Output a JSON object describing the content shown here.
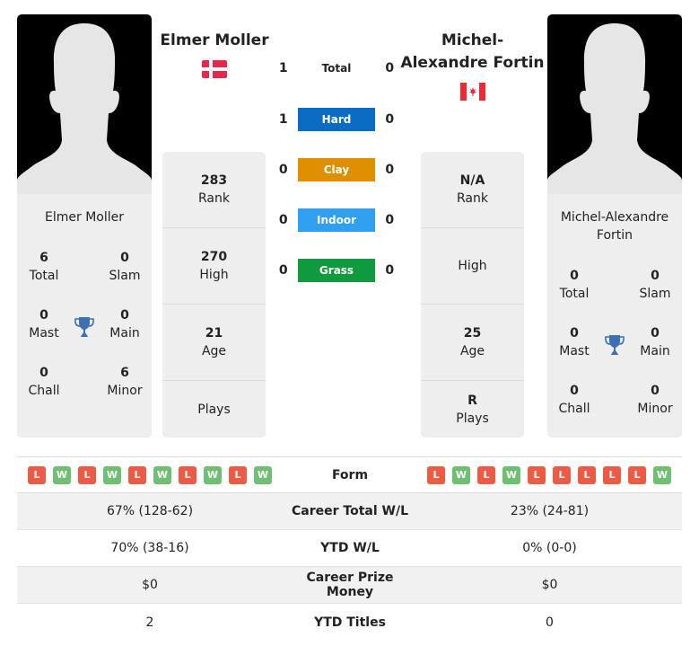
{
  "player1": {
    "name": "Elmer Moller",
    "card_name": "Elmer Moller",
    "country": "Denmark",
    "flag_icon": "denmark-flag-icon",
    "titles": {
      "total": {
        "value": "6",
        "label": "Total"
      },
      "slam": {
        "value": "0",
        "label": "Slam"
      },
      "mast": {
        "value": "0",
        "label": "Mast"
      },
      "main": {
        "value": "0",
        "label": "Main"
      },
      "chall": {
        "value": "0",
        "label": "Chall"
      },
      "minor": {
        "value": "6",
        "label": "Minor"
      }
    },
    "info": {
      "rank": {
        "value": "283",
        "label": "Rank"
      },
      "high": {
        "value": "270",
        "label": "High"
      },
      "age": {
        "value": "21",
        "label": "Age"
      },
      "plays": {
        "value": "",
        "label": "Plays"
      }
    },
    "form": [
      "L",
      "W",
      "L",
      "W",
      "L",
      "W",
      "L",
      "W",
      "L",
      "W"
    ]
  },
  "player2": {
    "name": "Michel-Alexandre Fortin",
    "name_line1": "Michel-",
    "name_line2": "Alexandre Fortin",
    "card_name": "Michel-Alexandre Fortin",
    "country": "Canada",
    "flag_icon": "canada-flag-icon",
    "titles": {
      "total": {
        "value": "0",
        "label": "Total"
      },
      "slam": {
        "value": "0",
        "label": "Slam"
      },
      "mast": {
        "value": "0",
        "label": "Mast"
      },
      "main": {
        "value": "0",
        "label": "Main"
      },
      "chall": {
        "value": "0",
        "label": "Chall"
      },
      "minor": {
        "value": "0",
        "label": "Minor"
      }
    },
    "info": {
      "rank": {
        "value": "N/A",
        "label": "Rank"
      },
      "high": {
        "value": "",
        "label": "High"
      },
      "age": {
        "value": "25",
        "label": "Age"
      },
      "plays": {
        "value": "R",
        "label": "Plays"
      }
    },
    "form": [
      "L",
      "W",
      "L",
      "W",
      "L",
      "L",
      "L",
      "L",
      "L",
      "W"
    ]
  },
  "h2h": [
    {
      "surface": "Total",
      "p1": "1",
      "p2": "0",
      "color": ""
    },
    {
      "surface": "Hard",
      "p1": "1",
      "p2": "0",
      "color": "#0a6cc2"
    },
    {
      "surface": "Clay",
      "p1": "0",
      "p2": "0",
      "color": "#dd8f00"
    },
    {
      "surface": "Indoor",
      "p1": "0",
      "p2": "0",
      "color": "#2f9ff0"
    },
    {
      "surface": "Grass",
      "p1": "0",
      "p2": "0",
      "color": "#0e9a3d"
    }
  ],
  "table": {
    "form_label": "Form",
    "rows": [
      {
        "label": "Career Total W/L",
        "p1": "67% (128-62)",
        "p2": "23% (24-81)"
      },
      {
        "label": "YTD W/L",
        "p1": "70% (38-16)",
        "p2": "0% (0-0)"
      },
      {
        "label": "Career Prize Money",
        "p1": "$0",
        "p2": "$0"
      },
      {
        "label": "YTD Titles",
        "p1": "2",
        "p2": "0"
      }
    ]
  },
  "colors": {
    "loss": "#ec5b45",
    "win": "#6fbf73",
    "trophy": "#3b6fb6"
  }
}
